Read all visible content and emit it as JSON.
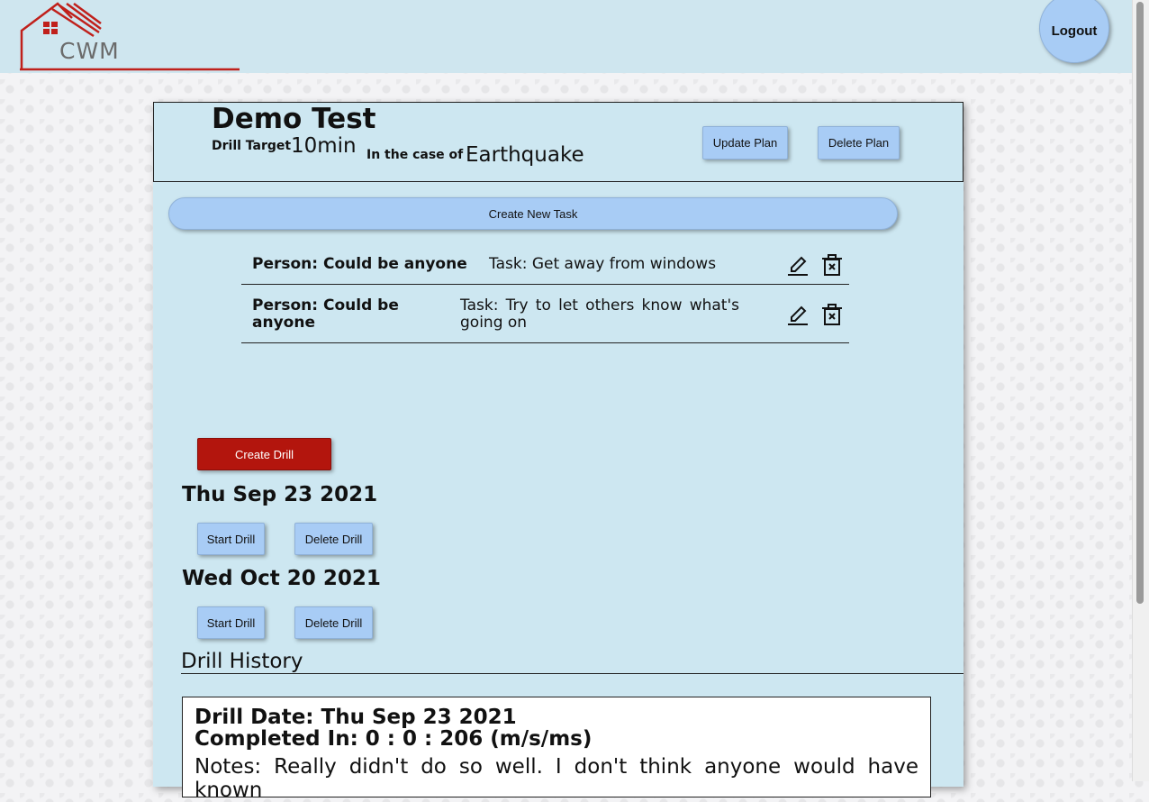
{
  "header": {
    "logo_text": "CWM",
    "logout_label": "Logout"
  },
  "plan": {
    "name": "Demo Test",
    "drill_target_label": "Drill Target",
    "drill_target_value": "10min",
    "case_label": "In the case of",
    "case_value": "Earthquake",
    "update_label": "Update Plan",
    "delete_label": "Delete Plan"
  },
  "tasks": {
    "create_label": "Create New Task",
    "items": [
      {
        "person": "Person: Could be anyone",
        "task": "Task: Get away from windows"
      },
      {
        "person": "Person: Could be anyone",
        "task": "Task: Try to let others know what's going on"
      }
    ]
  },
  "drills": {
    "create_label": "Create Drill",
    "items": [
      {
        "date": "Thu Sep 23 2021",
        "start_label": "Start Drill",
        "delete_label": "Delete Drill"
      },
      {
        "date": "Wed Oct 20 2021",
        "start_label": "Start Drill",
        "delete_label": "Delete Drill"
      }
    ]
  },
  "history": {
    "title": "Drill History",
    "entries": [
      {
        "date_line": "Drill Date: Thu Sep 23 2021",
        "completed_line": "Completed In: 0 : 0 : 206 (m/s/ms)",
        "notes": "Notes: Really didn't do so well. I don't think anyone would have known"
      }
    ]
  },
  "colors": {
    "topbar": "#cfe6ef",
    "panel": "#cde7f1",
    "button": "#a8ccf5",
    "create_drill": "#b3150d",
    "logo_red": "#c0201b"
  }
}
